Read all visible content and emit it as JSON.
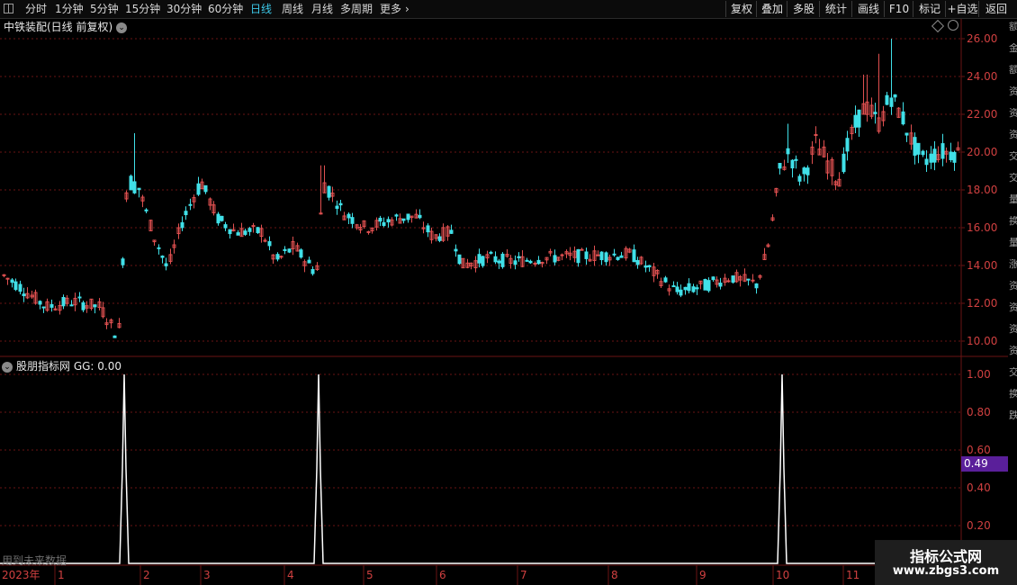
{
  "toolbar": {
    "periods": [
      {
        "label": "分时",
        "active": false
      },
      {
        "label": "1分钟",
        "active": false
      },
      {
        "label": "5分钟",
        "active": false
      },
      {
        "label": "15分钟",
        "active": false
      },
      {
        "label": "30分钟",
        "active": false
      },
      {
        "label": "60分钟",
        "active": false
      },
      {
        "label": "日线",
        "active": true
      },
      {
        "label": "周线",
        "active": false
      },
      {
        "label": "月线",
        "active": false
      },
      {
        "label": "多周期",
        "active": false
      },
      {
        "label": "更多",
        "active": false
      }
    ],
    "right_buttons": [
      "复权",
      "叠加",
      "多股",
      "统计",
      "画线",
      "F10",
      "标记",
      "+自选",
      "返回"
    ]
  },
  "main_chart": {
    "title": "中铁装配(日线 前复权)",
    "price_axis_labels": [
      "26.00",
      "24.00",
      "22.00",
      "20.00",
      "18.00",
      "16.00",
      "14.00",
      "12.00",
      "10.00"
    ]
  },
  "indicator": {
    "title": "股朋指标网 GG: 0.00",
    "axis_labels": [
      "1.00",
      "0.80",
      "0.60",
      "0.40",
      "0.20"
    ],
    "current_value": "0.49",
    "note": "用到未来数据"
  },
  "time_axis": {
    "year_label": "2023年",
    "months": [
      "1",
      "2",
      "3",
      "4",
      "5",
      "6",
      "7",
      "8",
      "9",
      "10",
      "11"
    ]
  },
  "side_text": "额金额资资资交交量换量涨资资资资交换跌",
  "watermark": {
    "title": "指标公式网",
    "url": "www.zbgs3.com"
  },
  "colors": {
    "up": "#e05050",
    "down": "#40e0e8",
    "grid": "#6a1414",
    "axis_text": "#d04040",
    "highlight": "#5a1f9a"
  },
  "chart_data": {
    "type": "candlestick",
    "ylim_price": [
      10,
      26
    ],
    "ylim_indicator": [
      0,
      1
    ],
    "indicator_spikes_x_months": [
      "2",
      "4",
      "10"
    ]
  }
}
